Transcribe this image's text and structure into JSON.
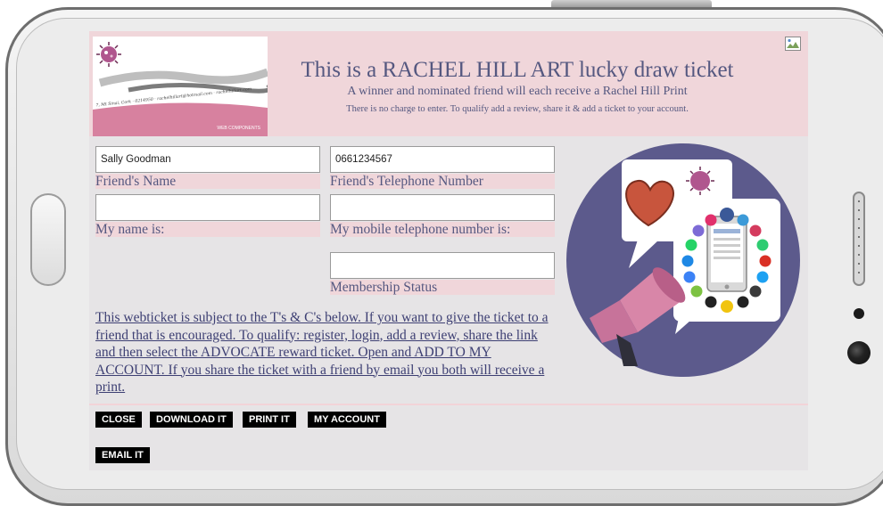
{
  "ticket": {
    "title": "This is a RACHEL HILL ART lucky draw ticket",
    "subtitle": "A winner and nominated friend will each receive a Rachel Hill Print",
    "note": "There is no charge to enter. To qualify add a review, share it & add a ticket to your account."
  },
  "logo": {
    "address": "7, Mt Sinai, Cork · 0214950 · rachelhillart@hotmail.com · rachelhillart.com",
    "web": "WEB COMPONENTS"
  },
  "form": {
    "friend_name": {
      "value": "Sally Goodman",
      "label": "Friend's Name"
    },
    "friend_phone": {
      "value": "0661234567",
      "label": "Friend's Telephone Number"
    },
    "my_name": {
      "value": "",
      "label": "My name is:"
    },
    "my_phone": {
      "value": "",
      "label": "My mobile telephone number is:"
    },
    "membership": {
      "value": "",
      "label": "Membership Status"
    }
  },
  "terms_text": "This webticket is subject to the T's & C's below. If you want to give the ticket to a friend that is encouraged. To qualify: register, login, add a review, share the link and then select the ADVOCATE reward ticket. Open and ADD TO MY ACCOUNT. If you share the ticket with a friend by email you both will receive a print.",
  "buttons": {
    "close": "CLOSE",
    "download": "DOWNLOAD IT",
    "print": "PRINT IT",
    "account": "MY ACCOUNT",
    "email": "EMAIL IT"
  },
  "icons": [
    "broken-image-icon",
    "heart-icon",
    "megaphone-icon",
    "smartphone-icon",
    "social-app-icons"
  ],
  "colors": {
    "header_band": "#f0d6da",
    "title_text": "#555880",
    "link_text": "#3d3f73",
    "promo_circle": "#5c5a8c",
    "heart": "#c8553d",
    "megaphone": "#d886a8",
    "button_bg": "#000000"
  }
}
